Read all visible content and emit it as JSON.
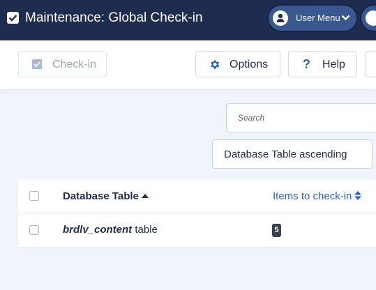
{
  "header": {
    "title": "Maintenance: Global Check-in",
    "user_menu_label": "User Menu"
  },
  "toolbar": {
    "checkin_label": "Check-in",
    "options_label": "Options",
    "help_label": "Help",
    "help_icon": "?"
  },
  "filters": {
    "search_placeholder": "Search",
    "sort_value": "Database Table ascending"
  },
  "table": {
    "columns": [
      "Database Table",
      "Items to check-in"
    ],
    "rows": [
      {
        "table_prefix": "brdlv_content",
        "table_suffix": " table",
        "count": "5"
      }
    ]
  },
  "colors": {
    "header_bg": "#1e2d4f",
    "accent": "#2a62c3",
    "badge_bg": "#3a4049"
  },
  "icons": {
    "header": "checkbox-icon",
    "user": "user-icon",
    "chevron": "chevron-down-icon",
    "options": "gear-icon",
    "help": "question-icon"
  }
}
